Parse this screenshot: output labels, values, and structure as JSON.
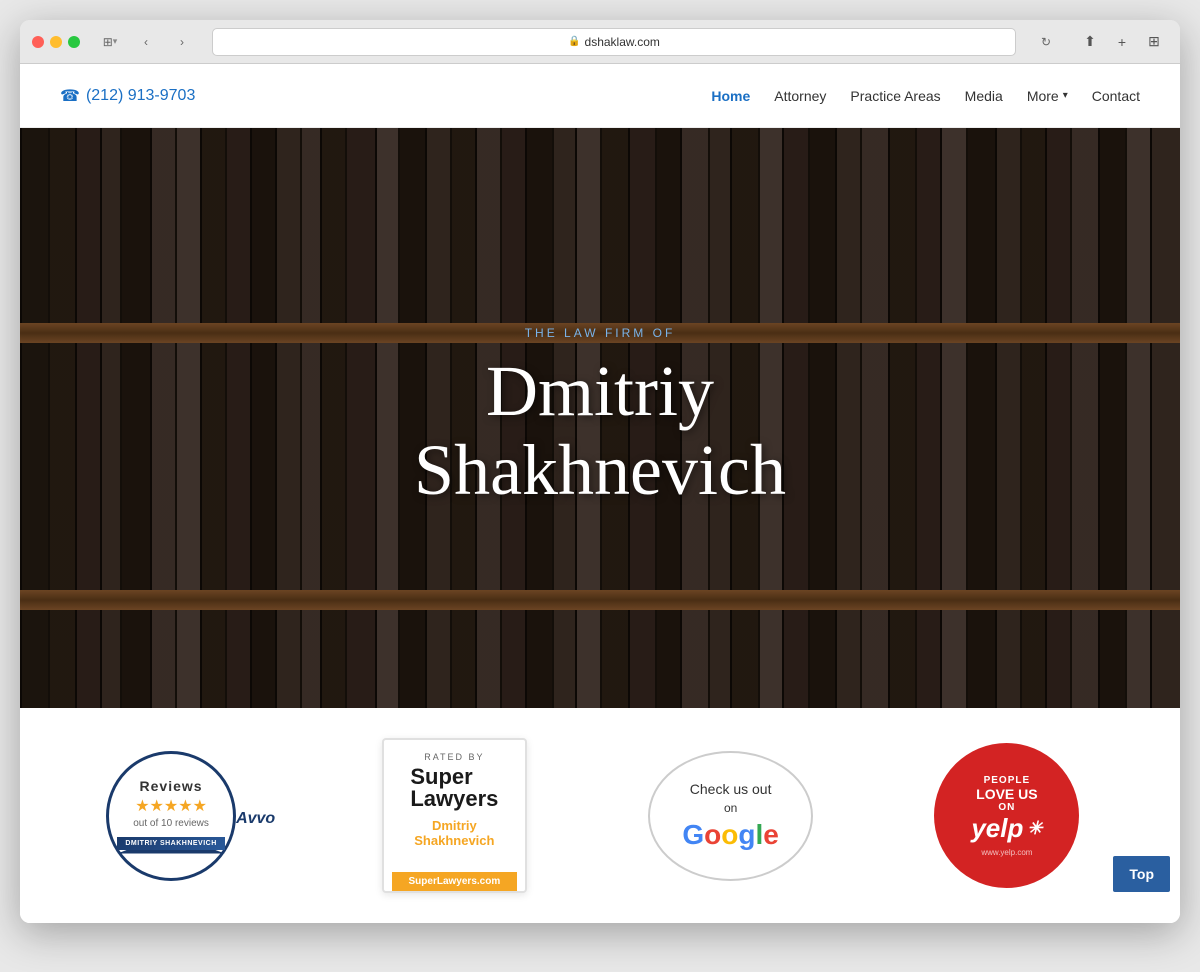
{
  "browser": {
    "url": "dshaklaw.com",
    "back_btn": "‹",
    "forward_btn": "›"
  },
  "header": {
    "phone_icon": "☎",
    "phone": "(212) 913-9703",
    "nav": {
      "home": "Home",
      "attorney": "Attorney",
      "practice_areas": "Practice Areas",
      "media": "Media",
      "more": "More",
      "contact": "Contact"
    }
  },
  "hero": {
    "subtitle": "THE LAW FIRM OF",
    "title_line1": "Dmitriy",
    "title_line2": "Shakhnevich"
  },
  "badges": {
    "avvo": {
      "reviews_label": "Reviews",
      "stars": "★★★★★",
      "out_of": "out of 10 reviews",
      "name": "DMITRIY SHAKHNEVICH",
      "brand": "Avvo"
    },
    "super_lawyers": {
      "rated_by": "RATED BY",
      "title": "Super Lawyers",
      "name": "Dmitriy\nShakhnevich",
      "url": "SuperLawyers.com"
    },
    "google": {
      "line1": "Check us out",
      "line2": "on",
      "brand": "Google"
    },
    "yelp": {
      "line1": "PEOPLE",
      "line2": "LOVE US",
      "line3": "ON",
      "brand": "yelp",
      "url": "www.yelp.com"
    }
  },
  "top_button": {
    "label": "Top"
  }
}
